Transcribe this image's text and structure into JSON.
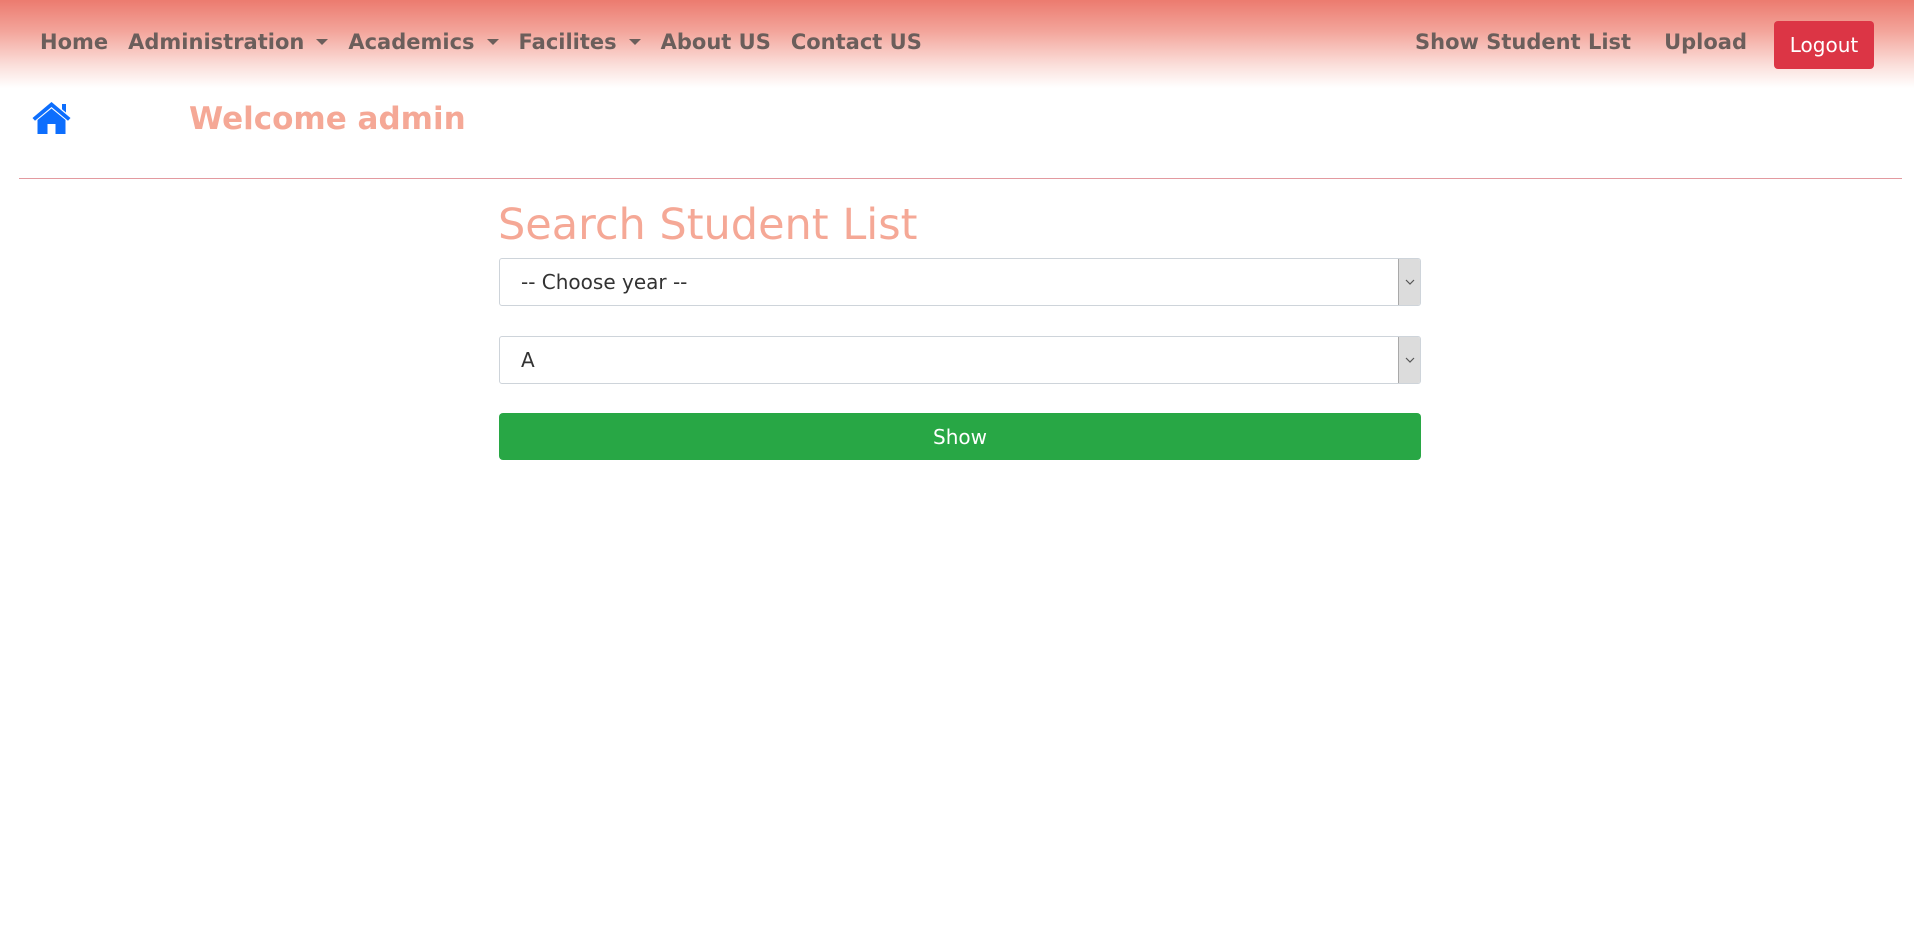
{
  "navbar": {
    "left_items": [
      {
        "label": "Home",
        "dropdown": false
      },
      {
        "label": "Administration",
        "dropdown": true
      },
      {
        "label": "Academics",
        "dropdown": true
      },
      {
        "label": "Facilites",
        "dropdown": true
      },
      {
        "label": "About US",
        "dropdown": false
      },
      {
        "label": "Contact US",
        "dropdown": false
      }
    ],
    "right_items": {
      "show_student_list": "Show Student List",
      "upload": "Upload",
      "logout": "Logout"
    }
  },
  "header": {
    "home_icon": "home-icon",
    "welcome_text": "Welcome admin"
  },
  "search": {
    "title": "Search Student List",
    "year_select_value": "-- Choose year --",
    "section_select_value": "A",
    "show_label": "Show"
  },
  "colors": {
    "navbar_gradient_top": "#ec7b6f",
    "nav_text": "#6b5e5b",
    "logout_button": "#dc3545",
    "accent_salmon": "#f5a896",
    "home_icon": "#0d6efd",
    "show_button": "#28a745",
    "divider": "#e39aa0"
  }
}
